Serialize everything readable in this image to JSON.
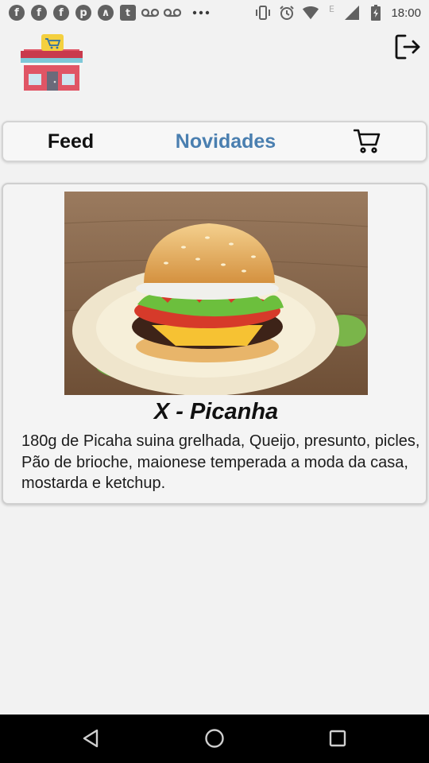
{
  "status_bar": {
    "notification_icons": [
      {
        "name": "facebook-icon",
        "glyph": "f"
      },
      {
        "name": "facebook-icon",
        "glyph": "f"
      },
      {
        "name": "facebook-icon",
        "glyph": "f"
      },
      {
        "name": "pinterest-icon",
        "glyph": "p"
      },
      {
        "name": "arc-icon",
        "glyph": "∧"
      },
      {
        "name": "twitch-icon",
        "glyph": "t"
      },
      {
        "name": "voicemail-icon"
      },
      {
        "name": "voicemail-icon"
      },
      {
        "name": "more-icon"
      }
    ],
    "network_label": "E",
    "time": "18:00"
  },
  "header": {
    "logo_icon": "store-cart-icon",
    "logout_icon": "logout-icon"
  },
  "tabs": [
    {
      "label": "Feed",
      "active": false
    },
    {
      "label": "Novidades",
      "active": true
    },
    {
      "icon": "cart-icon"
    }
  ],
  "product": {
    "image_icon": "burger-image",
    "title": "X - Picanha",
    "description": "180g de Picaha suina grelhada, Queijo, presunto, picles, Pão de brioche, maionese temperada a moda da casa, mostarda e ketchup."
  },
  "colors": {
    "active_tab": "#4a7fb0",
    "background": "#f2f2f2"
  },
  "navigation": {
    "back_icon": "back-icon",
    "home_icon": "home-icon",
    "recents_icon": "recents-icon"
  }
}
